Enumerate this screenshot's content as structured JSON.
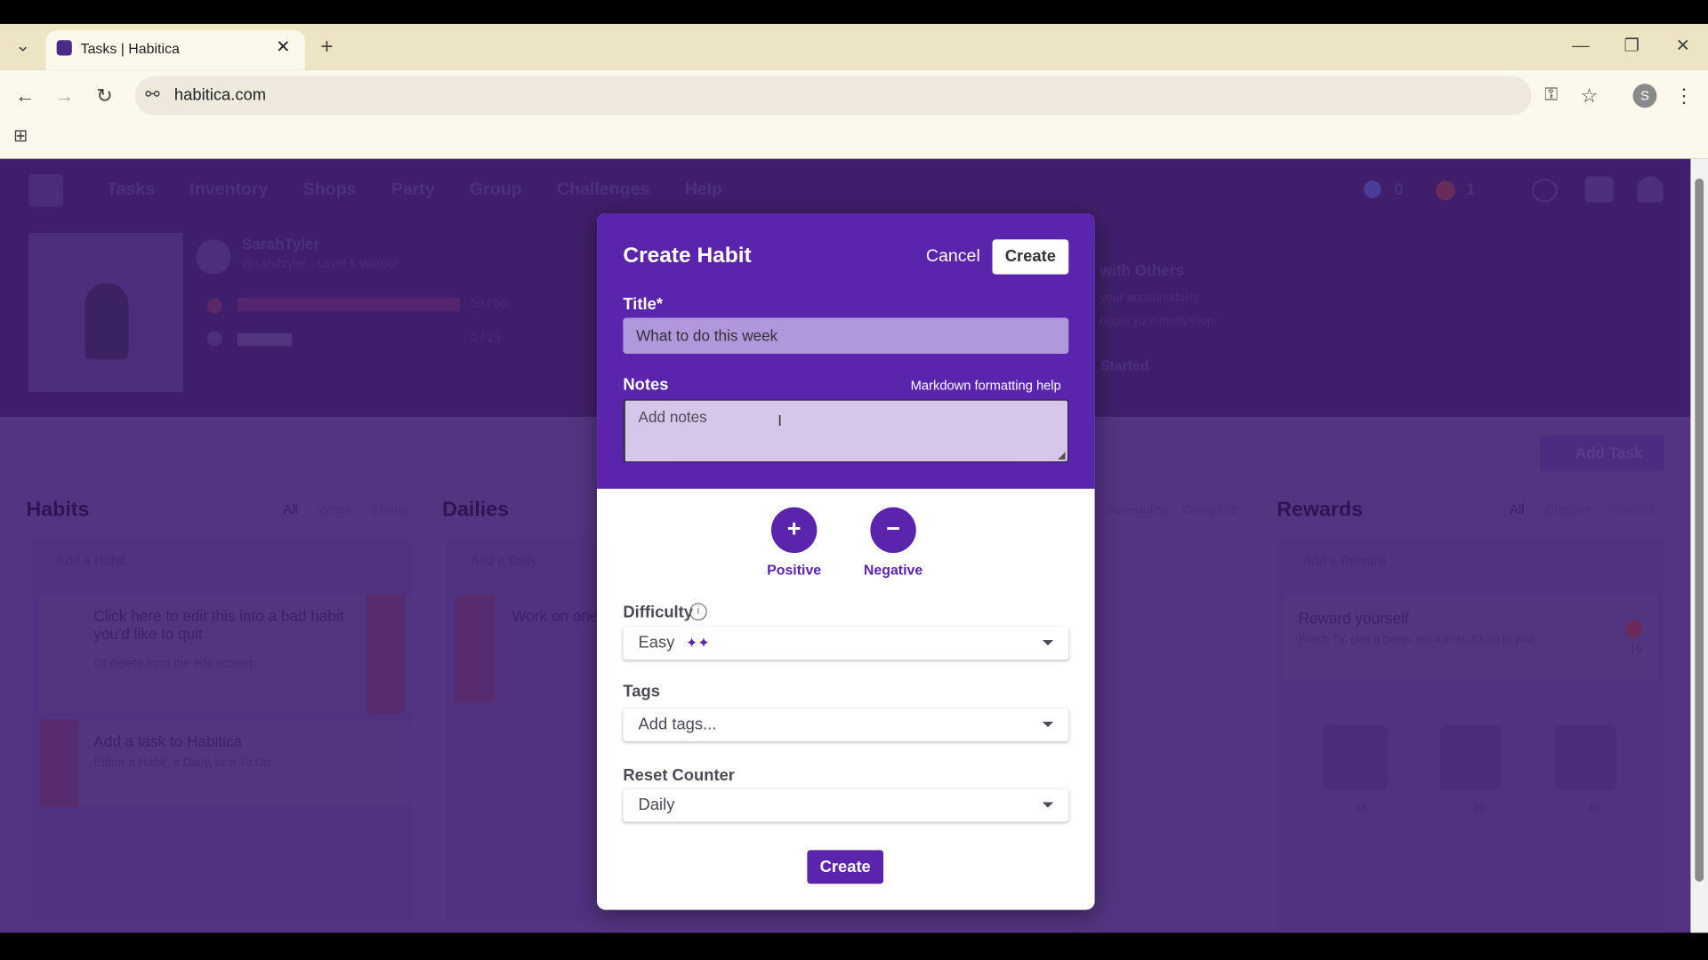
{
  "browser": {
    "tab_title": "Tasks | Habitica",
    "url": "habitica.com"
  },
  "nav": {
    "items": [
      "Tasks",
      "Inventory",
      "Shops",
      "Party",
      "Group",
      "Challenges",
      "Help"
    ],
    "gems": "0",
    "gold": "1"
  },
  "profile": {
    "name": "SarahTyler",
    "sub": "@sarahtyler · Level 1 Warrior",
    "hp": "50 / 50",
    "xp": "0 / 25"
  },
  "guide": {
    "title": "with Others",
    "line1": "your accountability",
    "line2": "boost your motivation",
    "link": "Started"
  },
  "board": {
    "add_task": "Add Task",
    "habits": {
      "title": "Habits",
      "filters": [
        "All",
        "Weak",
        "Strong"
      ],
      "add": "Add a Habit",
      "items": [
        {
          "title": "Click here to edit this into a bad habit you'd like to quit",
          "note": "Or delete from the edit screen"
        },
        {
          "title": "Add a task to Habitica",
          "note": "Either a Habit, a Daily, or a To Do"
        }
      ]
    },
    "dailies": {
      "title": "Dailies",
      "add": "Add a Daily",
      "item": "Work on one"
    },
    "todos": {
      "filters": [
        "Scheduled",
        "Complete"
      ]
    },
    "rewards": {
      "title": "Rewards",
      "filters": [
        "All",
        "Custom",
        "Wishlist"
      ],
      "add": "Add a Reward",
      "item": "Reward yourself",
      "item_note": "Watch TV, play a game, eat a treat, it's up to you!",
      "prices": [
        "10",
        "25",
        "40",
        "40"
      ]
    }
  },
  "modal": {
    "title": "Create Habit",
    "cancel": "Cancel",
    "create_top": "Create",
    "title_label": "Title*",
    "title_value": "What to do this week",
    "notes_label": "Notes",
    "markdown_help": "Markdown formatting help",
    "notes_placeholder": "Add notes",
    "positive": "Positive",
    "negative": "Negative",
    "positive_symbol": "+",
    "negative_symbol": "−",
    "difficulty_label": "Difficulty",
    "difficulty_value": "Easy",
    "difficulty_stars": "✦✦",
    "tags_label": "Tags",
    "tags_placeholder": "Add tags...",
    "reset_label": "Reset Counter",
    "reset_value": "Daily",
    "create_bottom": "Create"
  },
  "colors": {
    "primary": "#5b24ac",
    "overlay_header": "#3f1f6b",
    "overlay_body": "#523480"
  }
}
